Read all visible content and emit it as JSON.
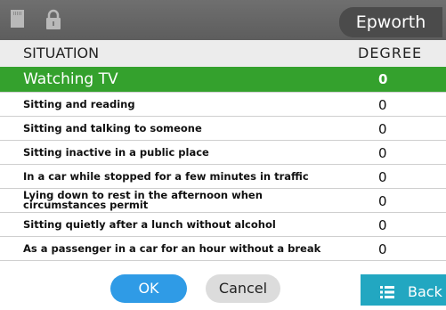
{
  "status_bar": {
    "sd_icon": "sd-card-icon",
    "lock_icon": "lock-icon",
    "title": "Epworth"
  },
  "header": {
    "situation": "SITUATION",
    "degree": "DEGREE"
  },
  "rows": [
    {
      "label": "Watching TV",
      "value": "0",
      "selected": true
    },
    {
      "label": "Sitting and reading",
      "value": "0"
    },
    {
      "label": "Sitting and talking to someone",
      "value": "0"
    },
    {
      "label": "Sitting inactive in a public place",
      "value": "0"
    },
    {
      "label": "In a car while stopped for a few minutes in traffic",
      "value": "0"
    },
    {
      "label": "Lying down to rest in the afternoon when circumstances permit",
      "value": "0"
    },
    {
      "label": "Sitting quietly after a lunch without alcohol",
      "value": "0"
    },
    {
      "label": "As a passenger in a car for an hour without a break",
      "value": "0"
    }
  ],
  "buttons": {
    "ok": "OK",
    "cancel": "Cancel",
    "back": "Back",
    "back_icon": "list-icon"
  },
  "colors": {
    "selected_row": "#34a12d",
    "ok_button": "#2f9be6",
    "back_button": "#22a7c1",
    "top_bar": "#666666"
  }
}
